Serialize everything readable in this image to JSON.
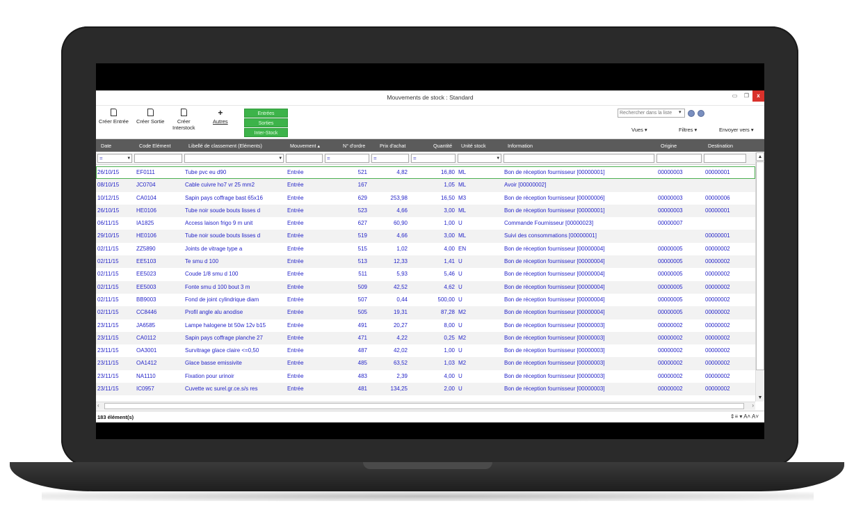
{
  "window": {
    "title": "Mouvements de stock : Standard",
    "minimize": "▭",
    "restore": "❐",
    "close": "x"
  },
  "toolbar": {
    "creer_entree": "Créer Entrée",
    "creer_sortie": "Créer Sortie",
    "creer_interstock_1": "Créer",
    "creer_interstock_2": "Interstock",
    "autres": "Autres",
    "mv_entrees": "Entrées",
    "mv_sorties": "Sorties",
    "mv_interstock": "Inter-Stock",
    "search_placeholder": "Rechercher dans la liste",
    "vues": "Vues ▾",
    "filtres": "Filtres ▾",
    "envoyer": "Envoyer vers ▾"
  },
  "columns": {
    "date": "Date",
    "code": "Code Elément",
    "libelle": "Libellé de classement (Eléments)",
    "mouvement": "Mouvement ▴",
    "ordre": "N° d'ordre",
    "prix": "Prix d'achat",
    "quantite": "Quantité",
    "unite": "Unité stock",
    "information": "Information",
    "origine": "Origine",
    "destination": "Destination"
  },
  "filters": {
    "eq": "=",
    "dd": "▾"
  },
  "rows": [
    {
      "date": "26/10/15",
      "code": "EF0111",
      "libelle": "Tube pvc eu d90",
      "mouvement": "Entrée",
      "ordre": "521",
      "prix": "4,82",
      "quantite": "16,80",
      "unite": "ML",
      "info": "Bon de réception fournisseur [00000001]",
      "origine": "00000003",
      "destination": "00000001"
    },
    {
      "date": "08/10/15",
      "code": "JC0704",
      "libelle": "Cable cuivre ho7 vr 25 mm2",
      "mouvement": "Entrée",
      "ordre": "167",
      "prix": "",
      "quantite": "1,05",
      "unite": "ML",
      "info": "Avoir [00000002]",
      "origine": "",
      "destination": ""
    },
    {
      "date": "10/12/15",
      "code": "CA0104",
      "libelle": "Sapin pays coffrage bast 65x16",
      "mouvement": "Entrée",
      "ordre": "629",
      "prix": "253,98",
      "quantite": "16,50",
      "unite": "M3",
      "info": "Bon de réception fournisseur [00000006]",
      "origine": "00000003",
      "destination": "00000006"
    },
    {
      "date": "26/10/15",
      "code": "HE0106",
      "libelle": "Tube noir soude bouts lisses d",
      "mouvement": "Entrée",
      "ordre": "523",
      "prix": "4,66",
      "quantite": "3,00",
      "unite": "ML",
      "info": "Bon de réception fournisseur [00000001]",
      "origine": "00000003",
      "destination": "00000001"
    },
    {
      "date": "06/11/15",
      "code": "IA1825",
      "libelle": "Access laison frigo 9 m unit",
      "mouvement": "Entrée",
      "ordre": "627",
      "prix": "60,90",
      "quantite": "1,00",
      "unite": "U",
      "info": "Commande Fournisseur [00000023]",
      "origine": "00000007",
      "destination": ""
    },
    {
      "date": "29/10/15",
      "code": "HE0106",
      "libelle": "Tube noir soude bouts lisses d",
      "mouvement": "Entrée",
      "ordre": "519",
      "prix": "4,66",
      "quantite": "3,00",
      "unite": "ML",
      "info": "Suivi des consommations [00000001]",
      "origine": "",
      "destination": "00000001"
    },
    {
      "date": "02/11/15",
      "code": "ZZ5890",
      "libelle": "Joints de vitrage type a",
      "mouvement": "Entrée",
      "ordre": "515",
      "prix": "1,02",
      "quantite": "4,00",
      "unite": "EN",
      "info": "Bon de réception fournisseur [00000004]",
      "origine": "00000005",
      "destination": "00000002"
    },
    {
      "date": "02/11/15",
      "code": "EE5103",
      "libelle": "Te smu d 100",
      "mouvement": "Entrée",
      "ordre": "513",
      "prix": "12,33",
      "quantite": "1,41",
      "unite": "U",
      "info": "Bon de réception fournisseur [00000004]",
      "origine": "00000005",
      "destination": "00000002"
    },
    {
      "date": "02/11/15",
      "code": "EE5023",
      "libelle": "Coude 1/8 smu d 100",
      "mouvement": "Entrée",
      "ordre": "511",
      "prix": "5,93",
      "quantite": "5,46",
      "unite": "U",
      "info": "Bon de réception fournisseur [00000004]",
      "origine": "00000005",
      "destination": "00000002"
    },
    {
      "date": "02/11/15",
      "code": "EE5003",
      "libelle": "Fonte smu d 100 bout 3 m",
      "mouvement": "Entrée",
      "ordre": "509",
      "prix": "42,52",
      "quantite": "4,62",
      "unite": "U",
      "info": "Bon de réception fournisseur [00000004]",
      "origine": "00000005",
      "destination": "00000002"
    },
    {
      "date": "02/11/15",
      "code": "BB9003",
      "libelle": "Fond de joint cylindrique diam",
      "mouvement": "Entrée",
      "ordre": "507",
      "prix": "0,44",
      "quantite": "500,00",
      "unite": "U",
      "info": "Bon de réception fournisseur [00000004]",
      "origine": "00000005",
      "destination": "00000002"
    },
    {
      "date": "02/11/15",
      "code": "CC8446",
      "libelle": "Profil angle alu anodise",
      "mouvement": "Entrée",
      "ordre": "505",
      "prix": "19,31",
      "quantite": "87,28",
      "unite": "M2",
      "info": "Bon de réception fournisseur [00000004]",
      "origine": "00000005",
      "destination": "00000002"
    },
    {
      "date": "23/11/15",
      "code": "JA6585",
      "libelle": "Lampe halogene bt 50w 12v b15",
      "mouvement": "Entrée",
      "ordre": "491",
      "prix": "20,27",
      "quantite": "8,00",
      "unite": "U",
      "info": "Bon de réception fournisseur [00000003]",
      "origine": "00000002",
      "destination": "00000002"
    },
    {
      "date": "23/11/15",
      "code": "CA0112",
      "libelle": "Sapin pays coffrage planche 27",
      "mouvement": "Entrée",
      "ordre": "471",
      "prix": "4,22",
      "quantite": "0,25",
      "unite": "M2",
      "info": "Bon de réception fournisseur [00000003]",
      "origine": "00000002",
      "destination": "00000002"
    },
    {
      "date": "23/11/15",
      "code": "OA3001",
      "libelle": "Survitrage glace claire <=0,50",
      "mouvement": "Entrée",
      "ordre": "487",
      "prix": "42,02",
      "quantite": "1,00",
      "unite": "U",
      "info": "Bon de réception fournisseur [00000003]",
      "origine": "00000002",
      "destination": "00000002"
    },
    {
      "date": "23/11/15",
      "code": "OA1412",
      "libelle": "Glace basse emissivite",
      "mouvement": "Entrée",
      "ordre": "485",
      "prix": "63,52",
      "quantite": "1,03",
      "unite": "M2",
      "info": "Bon de réception fournisseur [00000003]",
      "origine": "00000002",
      "destination": "00000002"
    },
    {
      "date": "23/11/15",
      "code": "NA1110",
      "libelle": "Fixation pour urinoir",
      "mouvement": "Entrée",
      "ordre": "483",
      "prix": "2,39",
      "quantite": "4,00",
      "unite": "U",
      "info": "Bon de réception fournisseur [00000003]",
      "origine": "00000002",
      "destination": "00000002"
    },
    {
      "date": "23/11/15",
      "code": "IC0957",
      "libelle": "Cuvette wc surel.gr.ce.s/s res",
      "mouvement": "Entrée",
      "ordre": "481",
      "prix": "134,25",
      "quantite": "2,00",
      "unite": "U",
      "info": "Bon de réception fournisseur [00000003]",
      "origine": "00000002",
      "destination": "00000002"
    }
  ],
  "status": {
    "count": "183 élément(s)",
    "tools": "⇕≡ ▾ A˄ A˅"
  },
  "colors": {
    "header_bg": "#5b5b5b",
    "row_text": "#2525c8",
    "green_button": "#3db34a",
    "close_button": "#d9312b",
    "selected_outline": "#4caf50"
  }
}
